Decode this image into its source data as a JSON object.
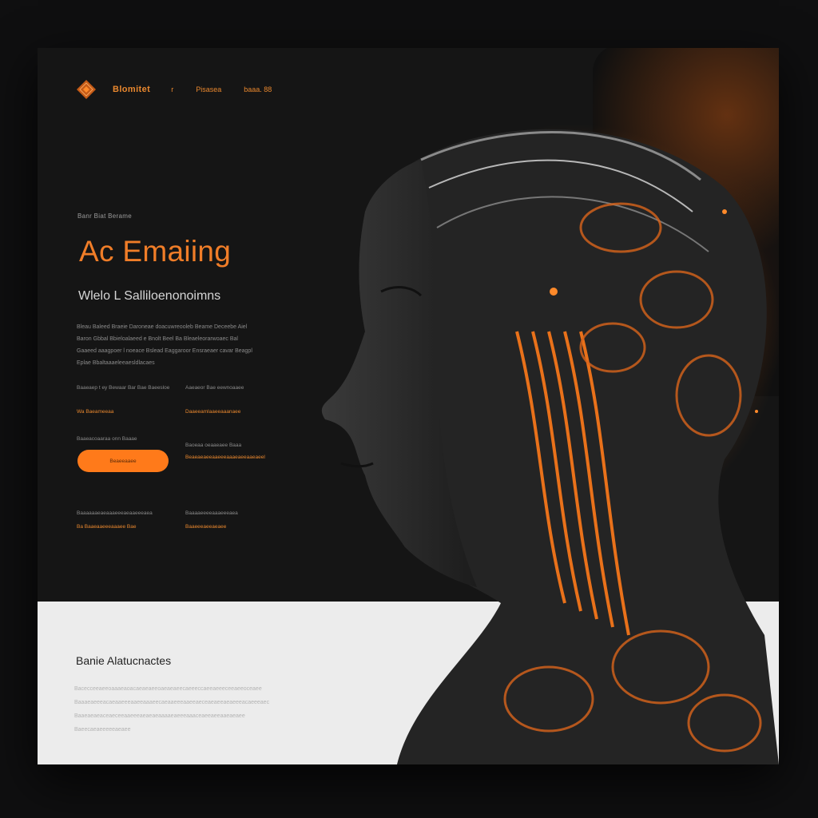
{
  "header": {
    "brand": "Blomitet",
    "nav": [
      "r",
      "Pisasea",
      "baaa. 88"
    ]
  },
  "hero": {
    "eyebrow": "Banr Biat Berame",
    "title": "Ac Emaiing",
    "subtitle": "Wlelo L Salliloenonoimns",
    "paragraph": "Bleau Baleed Braeie Daroneae doacuwreooleb Beame Deceebe Aiel Baron Gbbal Bbieloalaeed e Bnolt Beel Ba Bleaeleorarwoaec Bal Gaaeed aaagpoer l noeace Bslead Eaggaroor Ensraeaer cavar Beagpl Eplae Bbaltaaaeleeaesldlacaes",
    "info": [
      {
        "text": "Baaeaep t ey Bewaar Bar Bae Baeesloe",
        "link": "Wa Baeameeaa"
      },
      {
        "text": "Aaeaeor Bae eewnoaaee",
        "link": "Daaeeamlaaeeaaanaee"
      },
      {
        "text": "Baaeacoaaraa onn Baaae",
        "link": ""
      },
      {
        "text": "Baoeaa oeaaeaee Baaa",
        "link": "Beaeaeaeeaaeeeaaaeaeeaaeaeel"
      },
      {
        "text": "Baaaaaaeaeaaaeeeaeaaeeeaea",
        "link": "Ba Baaeaaeeeaaaee Bae"
      },
      {
        "text": "Baaaaeeeeaaaeeeaea",
        "link": "Baaeeeaeeaeaee"
      }
    ],
    "cta_label": "Beaeeaaee"
  },
  "lower": {
    "heading": "Banie Alatucnactes",
    "paragraph": "Bacecceeaeeoaaaeaoacaeaeaeeoaeaeaeecaeeeccaeeaeeeceeaeeoceaee Baaaeaeeeacaeaaeeeaaeeaaaeecaeaaeeeaaeeaeceaeaeeaeaeeeacaeeeaec Baaeaeaeaceaeceeaaeeeaeaeaeaaaaeaeeeaaaceaeeaeeaaeaeaee Baeecaeaeeeeeaeaee"
  },
  "colors": {
    "accent": "#f07d28",
    "dark_bg": "#151515",
    "light_bg": "#ececec"
  },
  "icons": [
    "diamond-logo-icon"
  ]
}
